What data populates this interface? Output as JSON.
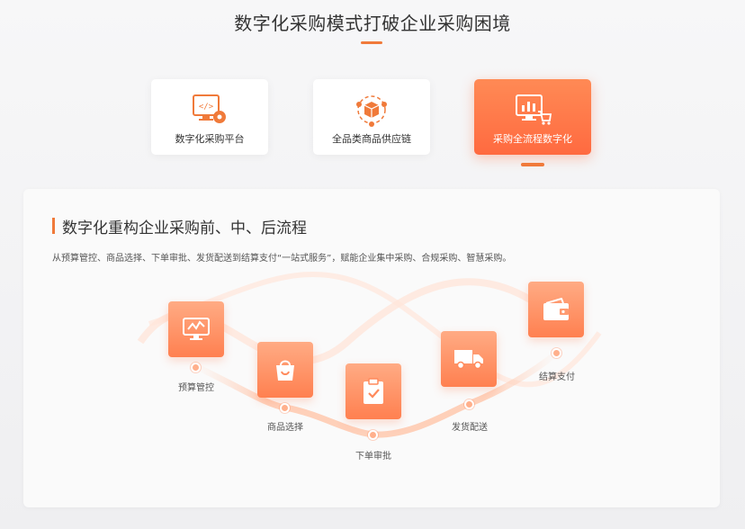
{
  "header": {
    "title": "数字化采购模式打破企业采购困境"
  },
  "tabs": [
    {
      "label": "数字化采购平台",
      "icon": "monitor-gear-icon",
      "active": false
    },
    {
      "label": "全品类商品供应链",
      "icon": "cube-network-icon",
      "active": false
    },
    {
      "label": "采购全流程数字化",
      "icon": "monitor-cart-icon",
      "active": true
    }
  ],
  "panel": {
    "heading": "数字化重构企业采购前、中、后流程",
    "description": "从预算管控、商品选择、下单审批、发货配送到结算支付“一站式服务”，赋能企业集中采购、合规采购、智慧采购。"
  },
  "steps": [
    {
      "label": "预算管控",
      "icon": "chart-monitor-icon"
    },
    {
      "label": "商品选择",
      "icon": "shopping-bag-icon"
    },
    {
      "label": "下单审批",
      "icon": "clipboard-check-icon"
    },
    {
      "label": "发货配送",
      "icon": "truck-icon"
    },
    {
      "label": "结算支付",
      "icon": "wallet-icon"
    }
  ],
  "colors": {
    "accent": "#f07a3a",
    "active_tab_top": "#ff8a55",
    "active_tab_bottom": "#ff6a40",
    "step_box_top": "#ffab84",
    "step_box_bottom": "#ff8050"
  }
}
